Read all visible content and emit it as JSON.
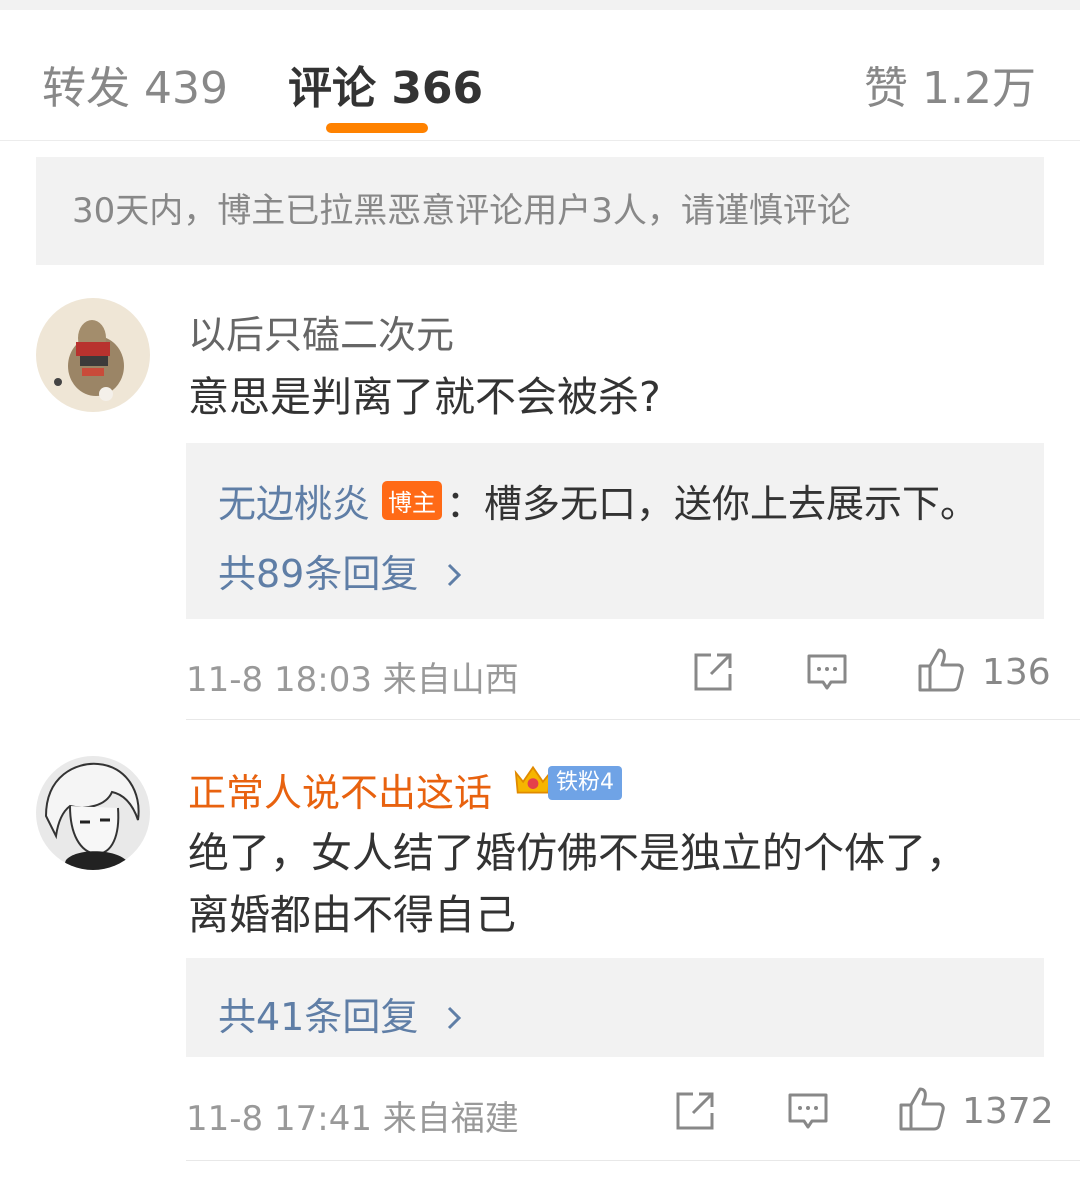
{
  "tabs": {
    "repost": "转发 439",
    "comment": "评论 366",
    "like": "赞 1.2万"
  },
  "notice": "30天内，博主已拉黑恶意评论用户3人，请谨慎评论",
  "comments": [
    {
      "username": "以后只磕二次元",
      "text": "意思是判离了就不会被杀?",
      "reply": {
        "author": "无边桃炎",
        "tag": "博主",
        "text": "：槽多无口，送你上去展示下。"
      },
      "reply_count": "共89条回复",
      "meta": "11-8 18:03  来自山西",
      "likes": "136"
    },
    {
      "username": "正常人说不出这话",
      "badge": "铁粉4",
      "text_line1": "绝了，女人结了婚仿佛不是独立的个体了，",
      "text_line2": "离婚都由不得自己",
      "reply_count": "共41条回复",
      "meta": "11-8 17:41  来自福建",
      "likes": "1372"
    }
  ],
  "colors": {
    "accent": "#ff8200",
    "link": "#5f7ea6",
    "username_highlight": "#e8620f",
    "bozhu_tag": "#ff6a16"
  },
  "icons": [
    "share-icon",
    "comment-icon",
    "thumbs-up-icon",
    "chevron-right-icon",
    "crown-icon"
  ]
}
